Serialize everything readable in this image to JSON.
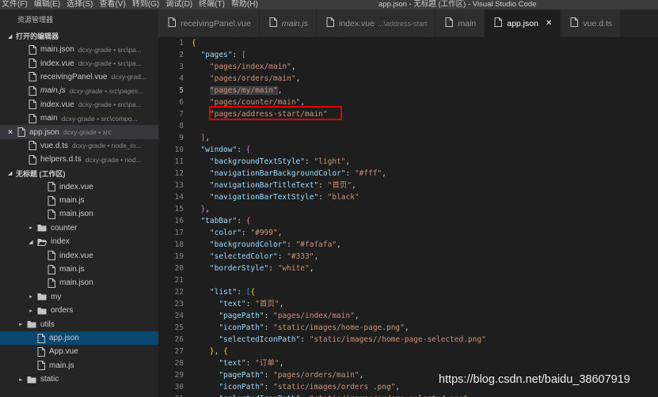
{
  "titlebar": {
    "menu": [
      "文件(F)",
      "编辑(E)",
      "选择(S)",
      "查看(V)",
      "转到(G)",
      "调试(D)",
      "终端(T)",
      "帮助(H)"
    ],
    "window_title": "app.json - 无标题 (工作区) - Visual Studio Code"
  },
  "sidebar": {
    "title": "资源管理器",
    "open_editors": {
      "label": "打开的编辑器",
      "items": [
        {
          "name": "main.json",
          "desc": "dcxy-grade • src\\pa...",
          "italic": false
        },
        {
          "name": "index.vue",
          "desc": "dcxy-grade • src\\pa...",
          "italic": false
        },
        {
          "name": "receivingPanel.vue",
          "desc": "dcxy-grad...",
          "italic": false
        },
        {
          "name": "main.js",
          "desc": "dcxy-grade • src\\pages...",
          "italic": true
        },
        {
          "name": "index.vue",
          "desc": "dcxy-grade • src\\pa...",
          "italic": false
        },
        {
          "name": "main",
          "desc": "dcxy-grade • src\\compo...",
          "italic": false
        },
        {
          "name": "app.json",
          "desc": "dcxy-grade • src",
          "italic": false,
          "active_close": true
        },
        {
          "name": "vue.d.ts",
          "desc": "dcxy-grade • node_m...",
          "italic": false
        },
        {
          "name": "helpers.d.ts",
          "desc": "dcxy-grade • nod...",
          "italic": false
        }
      ]
    },
    "workspace": {
      "label": "无标题 (工作区)",
      "items": [
        {
          "type": "file",
          "name": "index.vue",
          "depth": 3
        },
        {
          "type": "file",
          "name": "main.js",
          "depth": 3
        },
        {
          "type": "file",
          "name": "main.json",
          "depth": 3
        },
        {
          "type": "folder",
          "name": "counter",
          "depth": 2,
          "open": false
        },
        {
          "type": "folder",
          "name": "index",
          "depth": 2,
          "open": true
        },
        {
          "type": "file",
          "name": "index.vue",
          "depth": 3
        },
        {
          "type": "file",
          "name": "main.js",
          "depth": 3
        },
        {
          "type": "file",
          "name": "main.json",
          "depth": 3
        },
        {
          "type": "folder",
          "name": "my",
          "depth": 2,
          "open": false
        },
        {
          "type": "folder",
          "name": "orders",
          "depth": 2,
          "open": false
        },
        {
          "type": "folder",
          "name": "utils",
          "depth": 1,
          "open": false
        },
        {
          "type": "file",
          "name": "app.json",
          "depth": 2,
          "active": true
        },
        {
          "type": "file",
          "name": "App.vue",
          "depth": 2
        },
        {
          "type": "file",
          "name": "main.js",
          "depth": 2
        },
        {
          "type": "folder",
          "name": "static",
          "depth": 1,
          "open": false
        }
      ]
    }
  },
  "tabs": [
    {
      "label": "receivingPanel.vue",
      "desc": "",
      "italic": false,
      "active": false
    },
    {
      "label": "main.js",
      "desc": "",
      "italic": true,
      "active": false
    },
    {
      "label": "index.vue",
      "desc": "...\\address-start",
      "italic": false,
      "active": false
    },
    {
      "label": "main",
      "desc": "",
      "italic": false,
      "active": false
    },
    {
      "label": "app.json",
      "desc": "",
      "italic": false,
      "active": true
    },
    {
      "label": "vue.d.ts",
      "desc": "",
      "italic": false,
      "active": false
    }
  ],
  "editor": {
    "current_line": 5,
    "lines": [
      {
        "n": "1",
        "t": [
          [
            "b1",
            "{"
          ]
        ]
      },
      {
        "n": "2",
        "t": [
          [
            "p",
            "  "
          ],
          [
            "k",
            "\"pages\""
          ],
          [
            "p",
            ": "
          ],
          [
            "b2",
            "["
          ]
        ]
      },
      {
        "n": "3",
        "t": [
          [
            "p",
            "    "
          ],
          [
            "s",
            "\"pages/index/main\""
          ],
          [
            "p",
            ","
          ]
        ]
      },
      {
        "n": "4",
        "t": [
          [
            "p",
            "    "
          ],
          [
            "s",
            "\"pages/orders/main\""
          ],
          [
            "p",
            ","
          ]
        ]
      },
      {
        "n": "5",
        "t": [
          [
            "p",
            "    "
          ],
          [
            "s",
            "\"pages/my/main\"",
            "hl"
          ],
          [
            "p",
            ","
          ]
        ]
      },
      {
        "n": "6",
        "t": [
          [
            "p",
            "    "
          ],
          [
            "s",
            "\"pages/counter/main\""
          ],
          [
            "p",
            ","
          ]
        ]
      },
      {
        "n": "7",
        "t": [
          [
            "p",
            "    "
          ],
          [
            "s",
            "\"pages/address-start/main\""
          ]
        ]
      },
      {
        "n": "8",
        "t": []
      },
      {
        "n": "9",
        "t": [
          [
            "p",
            "  "
          ],
          [
            "b2",
            "]"
          ],
          [
            "p",
            ","
          ]
        ]
      },
      {
        "n": "10",
        "t": [
          [
            "p",
            "  "
          ],
          [
            "k",
            "\"window\""
          ],
          [
            "p",
            ": "
          ],
          [
            "b2",
            "{"
          ]
        ]
      },
      {
        "n": "11",
        "t": [
          [
            "p",
            "    "
          ],
          [
            "k",
            "\"backgroundTextStyle\""
          ],
          [
            "p",
            ": "
          ],
          [
            "s",
            "\"light\""
          ],
          [
            "p",
            ","
          ]
        ]
      },
      {
        "n": "12",
        "t": [
          [
            "p",
            "    "
          ],
          [
            "k",
            "\"navigationBarBackgroundColor\""
          ],
          [
            "p",
            ": "
          ],
          [
            "s",
            "\"#fff\""
          ],
          [
            "p",
            ","
          ]
        ]
      },
      {
        "n": "13",
        "t": [
          [
            "p",
            "    "
          ],
          [
            "k",
            "\"navigationBarTitleText\""
          ],
          [
            "p",
            ": "
          ],
          [
            "s",
            "\"首页\""
          ],
          [
            "p",
            ","
          ]
        ]
      },
      {
        "n": "14",
        "t": [
          [
            "p",
            "    "
          ],
          [
            "k",
            "\"navigationBarTextStyle\""
          ],
          [
            "p",
            ": "
          ],
          [
            "s",
            "\"black\""
          ]
        ]
      },
      {
        "n": "15",
        "t": [
          [
            "p",
            "  "
          ],
          [
            "b2",
            "}"
          ],
          [
            "p",
            ","
          ]
        ]
      },
      {
        "n": "16",
        "t": [
          [
            "p",
            "  "
          ],
          [
            "k",
            "\"tabBar\""
          ],
          [
            "p",
            ": "
          ],
          [
            "b2",
            "{"
          ]
        ]
      },
      {
        "n": "17",
        "t": [
          [
            "p",
            "    "
          ],
          [
            "k",
            "\"color\""
          ],
          [
            "p",
            ": "
          ],
          [
            "s",
            "\"#999\""
          ],
          [
            "p",
            ","
          ]
        ]
      },
      {
        "n": "18",
        "t": [
          [
            "p",
            "    "
          ],
          [
            "k",
            "\"backgroundColor\""
          ],
          [
            "p",
            ": "
          ],
          [
            "s",
            "\"#fafafa\""
          ],
          [
            "p",
            ","
          ]
        ]
      },
      {
        "n": "19",
        "t": [
          [
            "p",
            "    "
          ],
          [
            "k",
            "\"selectedColor\""
          ],
          [
            "p",
            ": "
          ],
          [
            "s",
            "\"#333\""
          ],
          [
            "p",
            ","
          ]
        ]
      },
      {
        "n": "20",
        "t": [
          [
            "p",
            "    "
          ],
          [
            "k",
            "\"borderStyle\""
          ],
          [
            "p",
            ": "
          ],
          [
            "s",
            "\"white\""
          ],
          [
            "p",
            ","
          ]
        ]
      },
      {
        "n": "21",
        "t": []
      },
      {
        "n": "22",
        "t": [
          [
            "p",
            "    "
          ],
          [
            "k",
            "\"list\""
          ],
          [
            "p",
            ": "
          ],
          [
            "b3",
            "["
          ],
          [
            "b1",
            "{"
          ]
        ]
      },
      {
        "n": "23",
        "t": [
          [
            "p",
            "      "
          ],
          [
            "k",
            "\"text\""
          ],
          [
            "p",
            ": "
          ],
          [
            "s",
            "\"首页\""
          ],
          [
            "p",
            ","
          ]
        ]
      },
      {
        "n": "24",
        "t": [
          [
            "p",
            "      "
          ],
          [
            "k",
            "\"pagePath\""
          ],
          [
            "p",
            ": "
          ],
          [
            "s",
            "\"pages/index/main\""
          ],
          [
            "p",
            ","
          ]
        ]
      },
      {
        "n": "25",
        "t": [
          [
            "p",
            "      "
          ],
          [
            "k",
            "\"iconPath\""
          ],
          [
            "p",
            ": "
          ],
          [
            "s",
            "\"static/images/home-page.png\""
          ],
          [
            "p",
            ","
          ]
        ]
      },
      {
        "n": "26",
        "t": [
          [
            "p",
            "      "
          ],
          [
            "k",
            "\"selectedIconPath\""
          ],
          [
            "p",
            ": "
          ],
          [
            "s",
            "\"static/images//home-page-selected.png\""
          ]
        ]
      },
      {
        "n": "27",
        "t": [
          [
            "p",
            "    "
          ],
          [
            "b1",
            "}"
          ],
          [
            "p",
            ", "
          ],
          [
            "b1",
            "{"
          ]
        ]
      },
      {
        "n": "28",
        "t": [
          [
            "p",
            "      "
          ],
          [
            "k",
            "\"text\""
          ],
          [
            "p",
            ": "
          ],
          [
            "s",
            "\"订单\""
          ],
          [
            "p",
            ","
          ]
        ]
      },
      {
        "n": "29",
        "t": [
          [
            "p",
            "      "
          ],
          [
            "k",
            "\"pagePath\""
          ],
          [
            "p",
            ": "
          ],
          [
            "s",
            "\"pages/orders/main\""
          ],
          [
            "p",
            ","
          ]
        ]
      },
      {
        "n": "30",
        "t": [
          [
            "p",
            "      "
          ],
          [
            "k",
            "\"iconPath\""
          ],
          [
            "p",
            ": "
          ],
          [
            "s",
            "\"static/images/orders .png\""
          ],
          [
            "p",
            ","
          ]
        ]
      },
      {
        "n": "31",
        "t": [
          [
            "p",
            "      "
          ],
          [
            "k",
            "\"selectedIconPath\""
          ],
          [
            "p",
            ": "
          ],
          [
            "s",
            "\"static/images/orders-selected.png\""
          ]
        ]
      }
    ]
  },
  "watermark": "https://blog.csdn.net/baidu_38607919",
  "colors": {
    "editor_bg": "#1e1e1e",
    "sidebar_bg": "#252526",
    "key": "#9cdcfe",
    "string": "#ce9178",
    "highlight_box": "#e00000",
    "active_row": "#094771"
  },
  "icons": {
    "file": "file-icon",
    "folder": "folder-icon",
    "close": "close-icon",
    "chevron": "chevron-icon"
  }
}
